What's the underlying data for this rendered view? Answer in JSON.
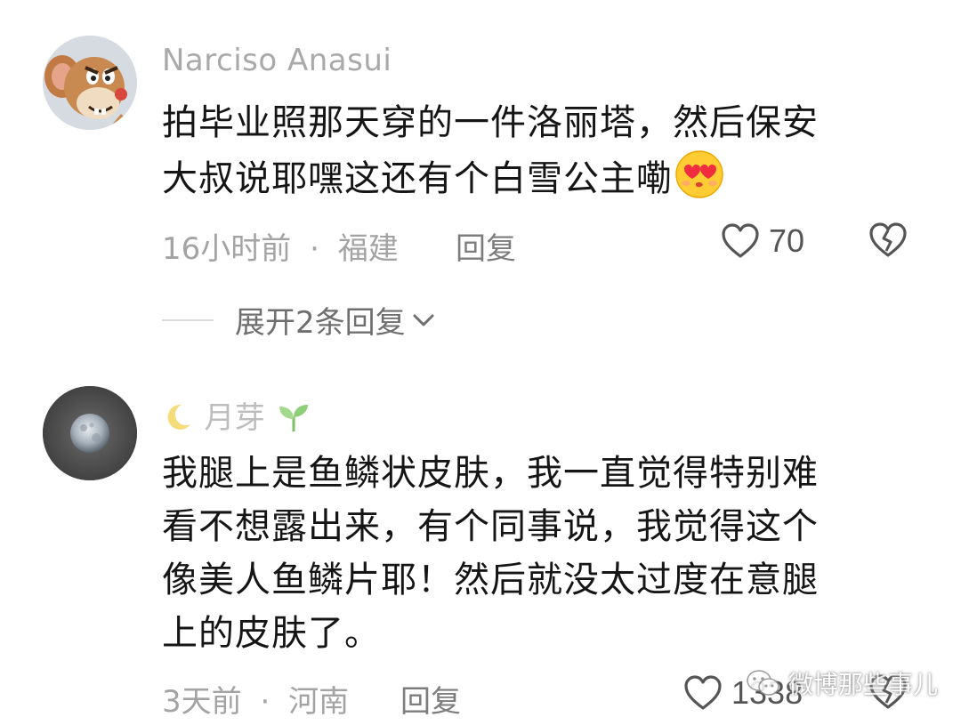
{
  "comments": [
    {
      "username": "Narciso Anasui",
      "avatar": "cartoon-mouse-avatar",
      "text_lines": [
        "拍毕业照那天穿的一件洛丽塔，然后保安",
        "大叔说耶嘿这还有个白雪公主嘞"
      ],
      "text_emoji": "😍",
      "time": "16小时前",
      "sep": "·",
      "location": "福建",
      "reply_label": "回复",
      "likes": "70",
      "expand_label": "展开2条回复"
    },
    {
      "username_prefix": "🌙",
      "username": "月芽",
      "username_suffix": "🌱",
      "avatar": "moon-avatar",
      "text_lines": [
        "我腿上是鱼鳞状皮肤，我一直觉得特别难",
        "看不想露出来，有个同事说，我觉得这个",
        "像美人鱼鳞片耶！然后就没太过度在意腿",
        "上的皮肤了。"
      ],
      "time": "3天前",
      "sep": "·",
      "location": "河南",
      "reply_label": "回复",
      "likes": "1338"
    }
  ],
  "watermark": {
    "text": "微博那些事儿",
    "icon": "wechat-icon"
  },
  "colors": {
    "username": "#a9a9a9",
    "text": "#151515",
    "meta": "#a3a3a3",
    "icon": "#555555"
  }
}
